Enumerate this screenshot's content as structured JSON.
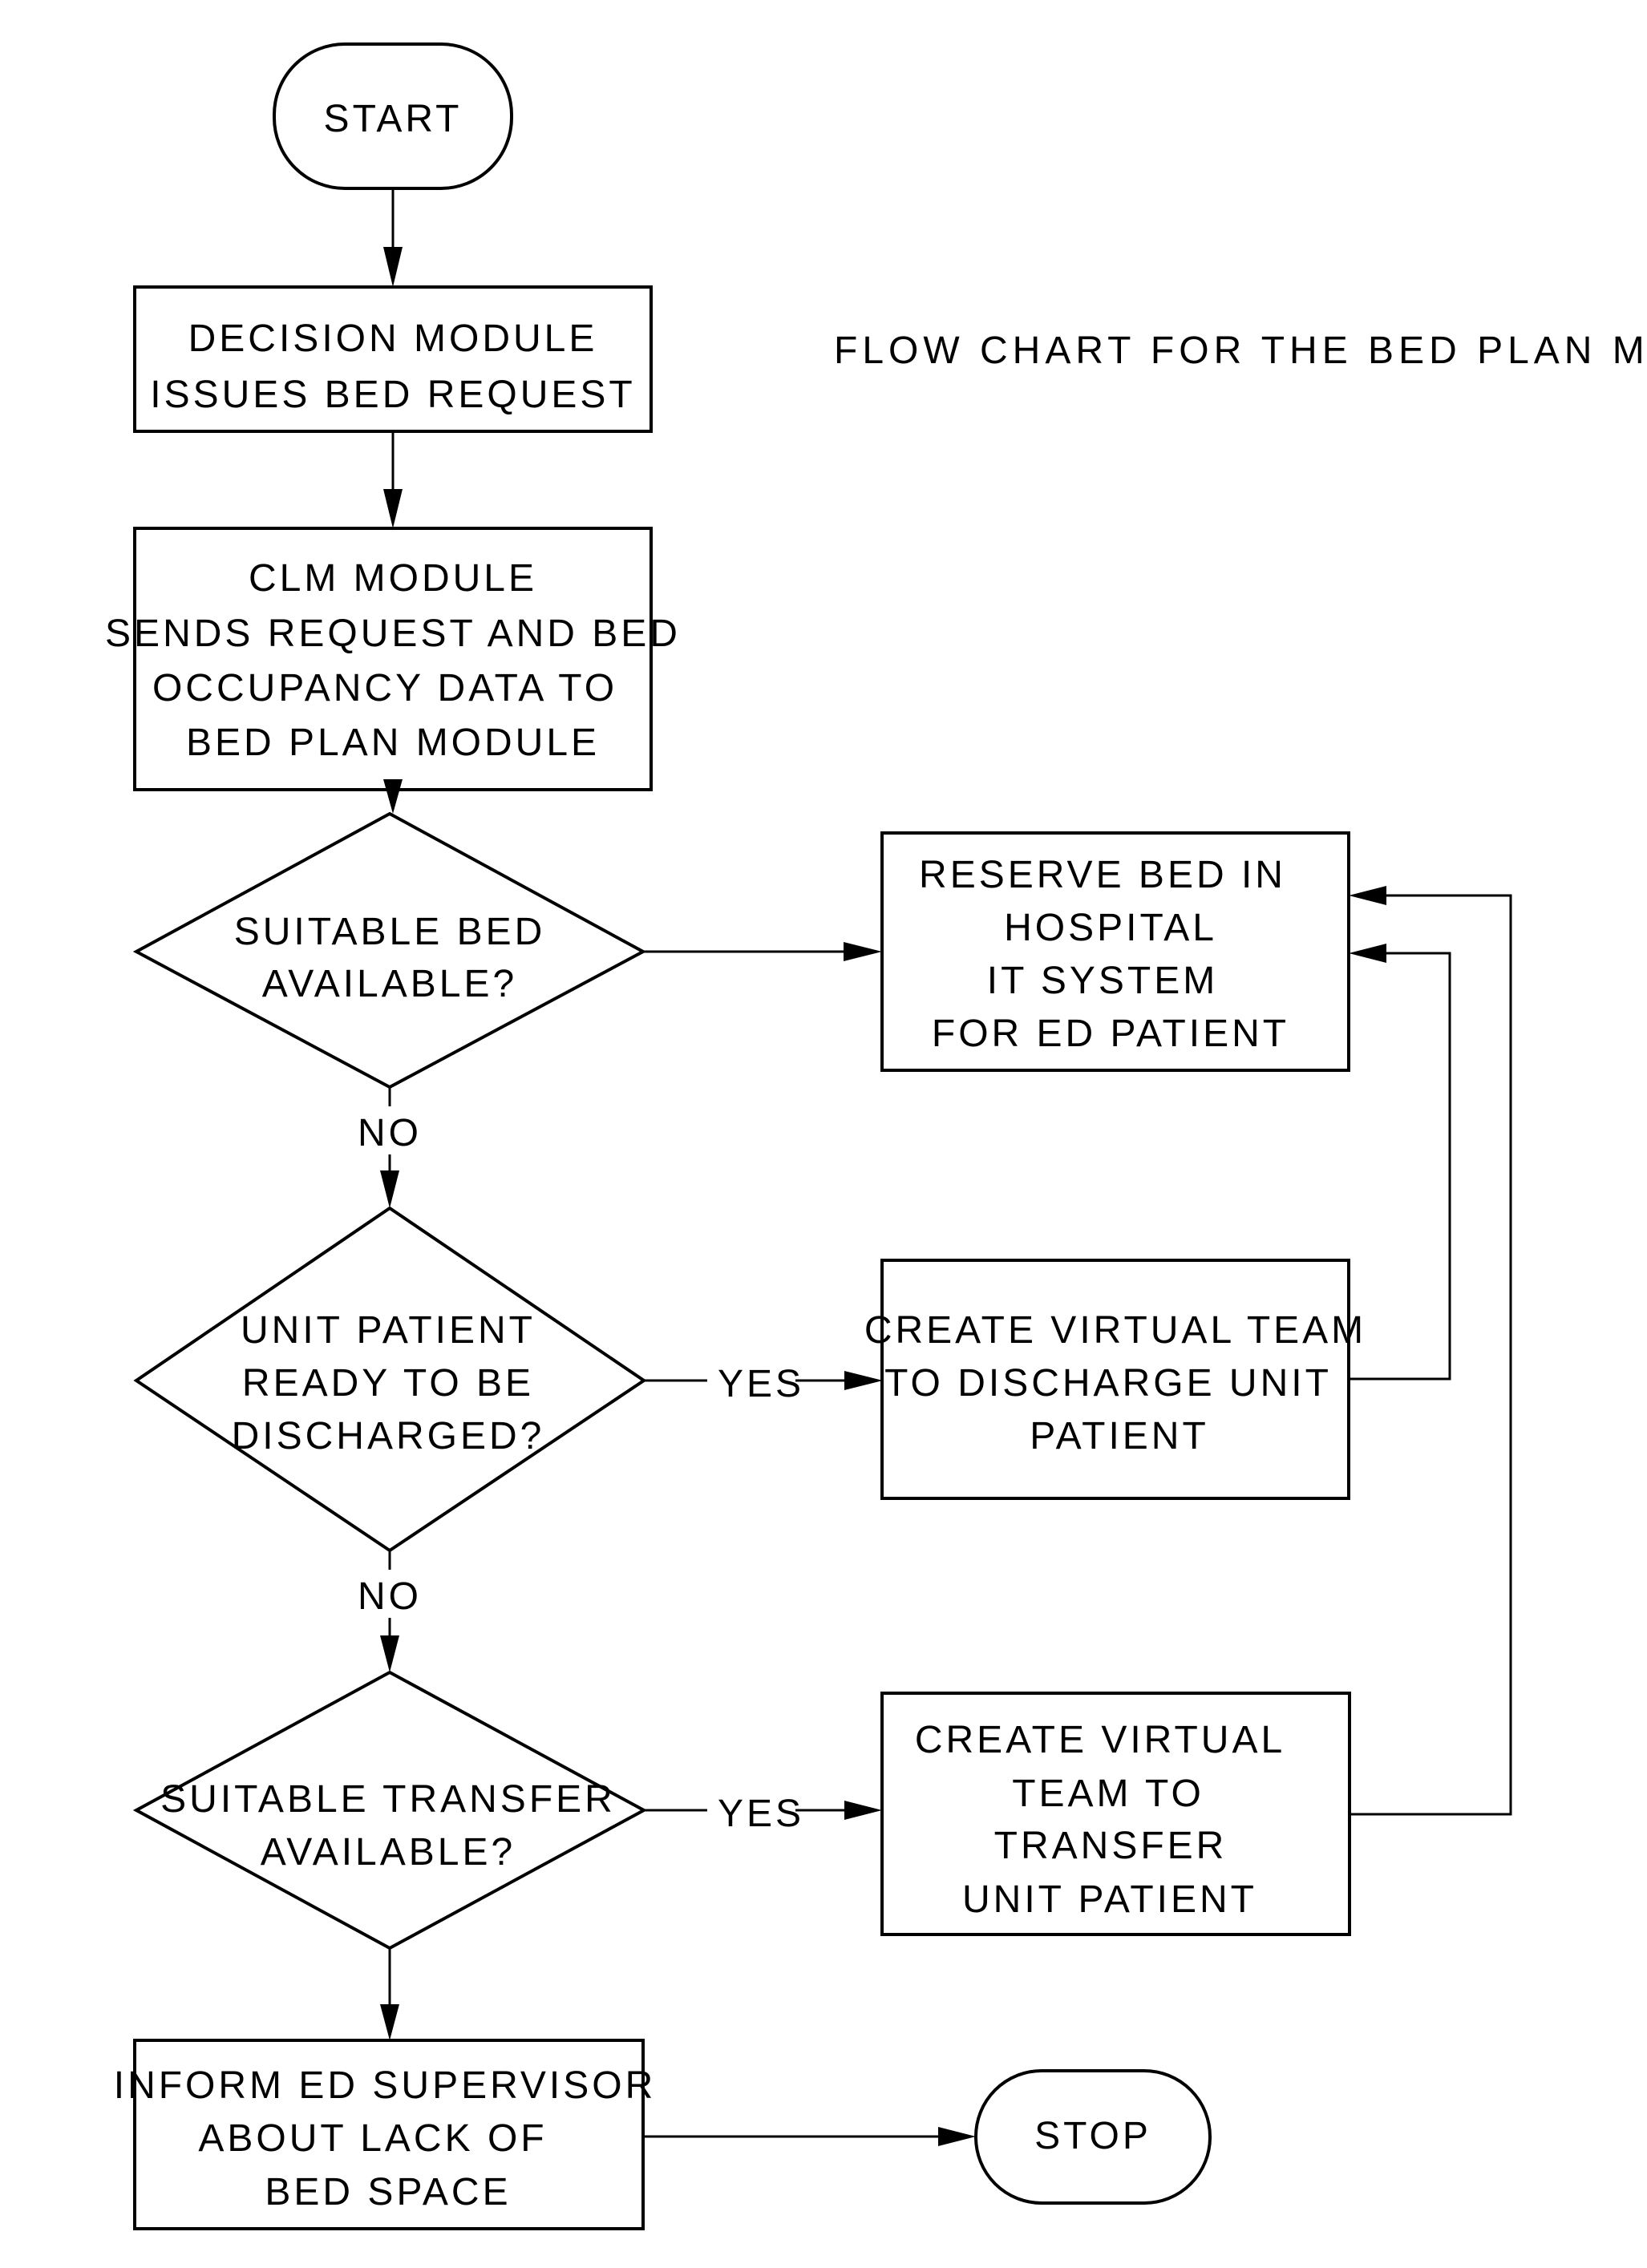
{
  "title": "FLOW CHART FOR THE BED PLAN MODULE",
  "colors": {
    "ink": "#000000",
    "paper": "#ffffff"
  },
  "nodes": {
    "start": {
      "type": "terminal",
      "lines": [
        "START"
      ]
    },
    "decision_module": {
      "type": "process",
      "lines": [
        "DECISION MODULE",
        "ISSUES BED REQUEST"
      ]
    },
    "clm_module": {
      "type": "process",
      "lines": [
        "CLM MODULE",
        "SENDS REQUEST AND BED",
        "OCCUPANCY DATA TO",
        "BED PLAN MODULE"
      ]
    },
    "suitable_bed": {
      "type": "decision",
      "lines": [
        "SUITABLE BED",
        "AVAILABLE?"
      ]
    },
    "reserve_bed": {
      "type": "process",
      "lines": [
        "RESERVE BED IN",
        "HOSPITAL",
        "IT SYSTEM",
        "FOR ED PATIENT"
      ]
    },
    "unit_patient_ready": {
      "type": "decision",
      "lines": [
        "UNIT PATIENT",
        "READY TO BE",
        "DISCHARGED?"
      ]
    },
    "discharge_team": {
      "type": "process",
      "lines": [
        "CREATE VIRTUAL TEAM",
        "TO DISCHARGE UNIT",
        "PATIENT"
      ]
    },
    "suitable_transfer": {
      "type": "decision",
      "lines": [
        "SUITABLE TRANSFER",
        "AVAILABLE?"
      ]
    },
    "transfer_team": {
      "type": "process",
      "lines": [
        "CREATE VIRTUAL",
        "TEAM TO",
        "TRANSFER",
        "UNIT PATIENT"
      ]
    },
    "inform_supervisor": {
      "type": "process",
      "lines": [
        "INFORM ED SUPERVISOR",
        "ABOUT LACK OF",
        "BED SPACE"
      ]
    },
    "stop": {
      "type": "terminal",
      "lines": [
        "STOP"
      ]
    }
  },
  "edge_labels": {
    "no_1": "NO",
    "no_2": "NO",
    "yes_1": "YES",
    "yes_2": "YES"
  },
  "edges": [
    {
      "from": "start",
      "to": "decision_module",
      "label": ""
    },
    {
      "from": "decision_module",
      "to": "clm_module",
      "label": ""
    },
    {
      "from": "clm_module",
      "to": "suitable_bed",
      "label": ""
    },
    {
      "from": "suitable_bed",
      "to": "reserve_bed",
      "label": ""
    },
    {
      "from": "suitable_bed",
      "to": "unit_patient_ready",
      "label": "NO"
    },
    {
      "from": "unit_patient_ready",
      "to": "discharge_team",
      "label": "YES"
    },
    {
      "from": "discharge_team",
      "to": "reserve_bed",
      "label": ""
    },
    {
      "from": "unit_patient_ready",
      "to": "suitable_transfer",
      "label": "NO"
    },
    {
      "from": "suitable_transfer",
      "to": "transfer_team",
      "label": "YES"
    },
    {
      "from": "transfer_team",
      "to": "reserve_bed",
      "label": ""
    },
    {
      "from": "suitable_transfer",
      "to": "inform_supervisor",
      "label": ""
    },
    {
      "from": "inform_supervisor",
      "to": "stop",
      "label": ""
    }
  ]
}
